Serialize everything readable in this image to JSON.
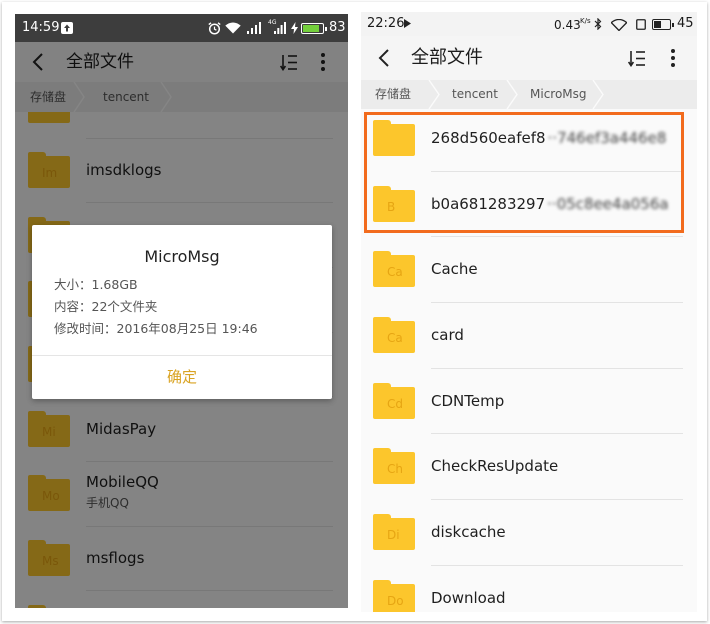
{
  "colors": {
    "folder": "#fcc62c",
    "folder_label": "#e6a513",
    "highlight_border": "#f26b1d",
    "dialog_button": "#d9a322",
    "battery_green": "#74cf3c"
  },
  "left_phone": {
    "status_bar": {
      "time": "14:59",
      "network_type": "4G",
      "battery_level": "83",
      "icons": [
        "upload-icon",
        "alarm-icon",
        "wifi-icon",
        "signal-icon",
        "signal-4g-icon",
        "charging-icon",
        "battery-icon"
      ]
    },
    "toolbar": {
      "title": "全部文件",
      "icons": [
        "back-icon",
        "sort-icon",
        "more-icon"
      ]
    },
    "breadcrumb": [
      {
        "label": "存储盘"
      },
      {
        "label": "tencent"
      }
    ],
    "files": [
      {
        "name": "",
        "icon_label": "Im"
      },
      {
        "name": "imsdklogs",
        "icon_label": "Im"
      },
      {
        "name": "",
        "icon_label": ""
      },
      {
        "name": "",
        "icon_label": ""
      },
      {
        "name": "",
        "icon_label": ""
      },
      {
        "name": "MidasPay",
        "icon_label": "Mi"
      },
      {
        "name": "MobileQQ",
        "subtitle": "手机QQ",
        "icon_label": "Mo"
      },
      {
        "name": "msflogs",
        "icon_label": "Ms"
      },
      {
        "name": "",
        "icon_label": ""
      }
    ],
    "dialog": {
      "title": "MicroMsg",
      "size": "大小：1.68GB",
      "contents": "内容：22个文件夹",
      "modified": "修改时间：2016年08月25日 19:46",
      "ok_label": "确定"
    }
  },
  "right_phone": {
    "status_bar": {
      "time": "22:26",
      "net_speed": "0.43",
      "net_speed_unit": "K/s",
      "battery_level": "45",
      "icons": [
        "play-icon",
        "bluetooth-icon",
        "wifi-icon",
        "screen-icon",
        "battery-icon"
      ]
    },
    "toolbar": {
      "title": "全部文件",
      "icons": [
        "back-icon",
        "sort-icon",
        "more-icon"
      ]
    },
    "breadcrumb": [
      {
        "label": "存储盘"
      },
      {
        "label": "tencent"
      },
      {
        "label": "MicroMsg"
      }
    ],
    "files": [
      {
        "name": "268d560eafef8",
        "name_blurred": "··746ef3a446e8",
        "icon_label": ""
      },
      {
        "name": "b0a681283297",
        "name_blurred": "··05c8ee4a056a",
        "icon_label": "B"
      },
      {
        "name": "Cache",
        "icon_label": "Ca"
      },
      {
        "name": "card",
        "icon_label": "Ca"
      },
      {
        "name": "CDNTemp",
        "icon_label": "Cd"
      },
      {
        "name": "CheckResUpdate",
        "icon_label": "Ch"
      },
      {
        "name": "diskcache",
        "icon_label": "Di"
      },
      {
        "name": "Download",
        "icon_label": "Do"
      }
    ]
  }
}
